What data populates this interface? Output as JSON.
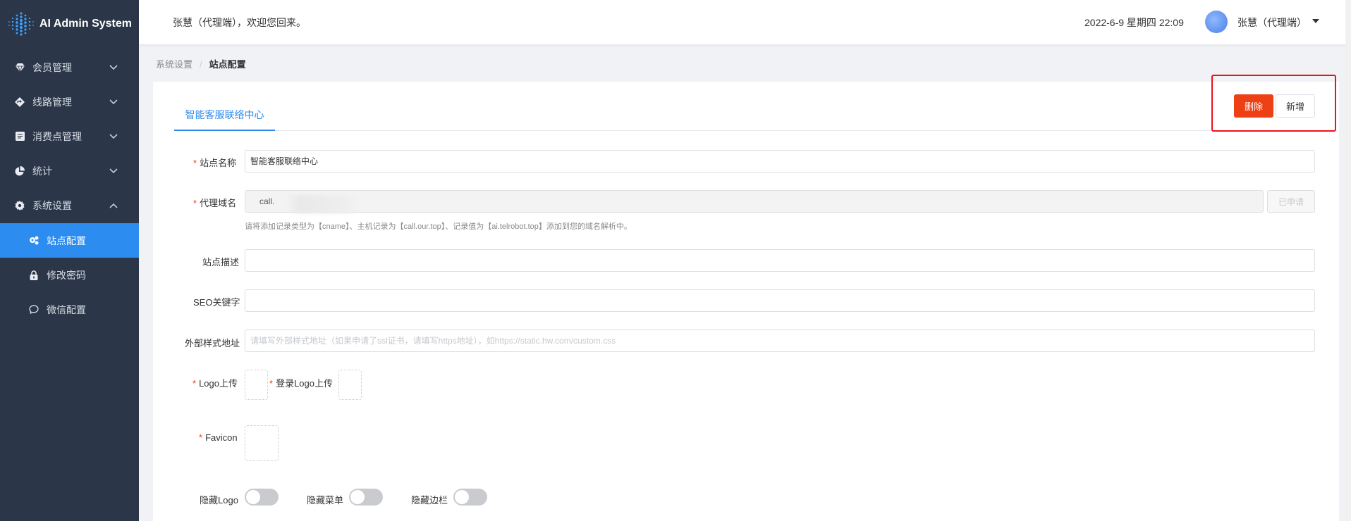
{
  "app": {
    "title": "AI Admin System"
  },
  "sidebar": {
    "items": [
      {
        "label": "会员管理",
        "icon": "diamond-icon"
      },
      {
        "label": "线路管理",
        "icon": "route-icon"
      },
      {
        "label": "消费点管理",
        "icon": "wallet-icon"
      },
      {
        "label": "统计",
        "icon": "pie-chart-icon"
      },
      {
        "label": "系统设置",
        "icon": "gear-icon",
        "expanded": true
      }
    ],
    "subitems": [
      {
        "label": "站点配置",
        "icon": "site-config-icon",
        "active": true
      },
      {
        "label": "修改密码",
        "icon": "lock-icon"
      },
      {
        "label": "微信配置",
        "icon": "chat-icon"
      }
    ],
    "active_color": "#2d8cf0",
    "bg_color": "#2b3648"
  },
  "header": {
    "welcome": "张慧（代理端），欢迎您回来。",
    "datetime": "2022-6-9 星期四 22:09",
    "username": "张慧（代理端）"
  },
  "breadcrumb": {
    "parent": "系统设置",
    "current": "站点配置"
  },
  "tabs": [
    {
      "label": "智能客服联络中心",
      "active": true
    }
  ],
  "actions": {
    "delete_label": "删除",
    "new_label": "新增",
    "delete_color": "#ed4014"
  },
  "form": {
    "site_name_label": "站点名称",
    "site_name_value": "智能客服联络中心",
    "domain_label": "代理域名",
    "domain_value": "call.",
    "domain_button": "已申请",
    "domain_hint": "请将添加记录类型为【cname】、主机记录为【call.our.top】、记录值为【ai.telrobot.top】添加到您的域名解析中。",
    "desc_label": "站点描述",
    "desc_value": "",
    "seo_label": "SEO关键字",
    "seo_value": "",
    "css_label": "外部样式地址",
    "css_placeholder": "请填写外部样式地址（如果申请了ssl证书，请填写https地址），如https://static.hw.com/custom.css",
    "logo_label": "Logo上传",
    "login_logo_label": "登录Logo上传",
    "favicon_label": "Favicon",
    "hide_logo_label": "隐藏Logo",
    "hide_menu_label": "隐藏菜单",
    "hide_sidebar_label": "隐藏边栏",
    "hide_logo_on": false,
    "hide_menu_on": false,
    "hide_sidebar_on": false
  }
}
